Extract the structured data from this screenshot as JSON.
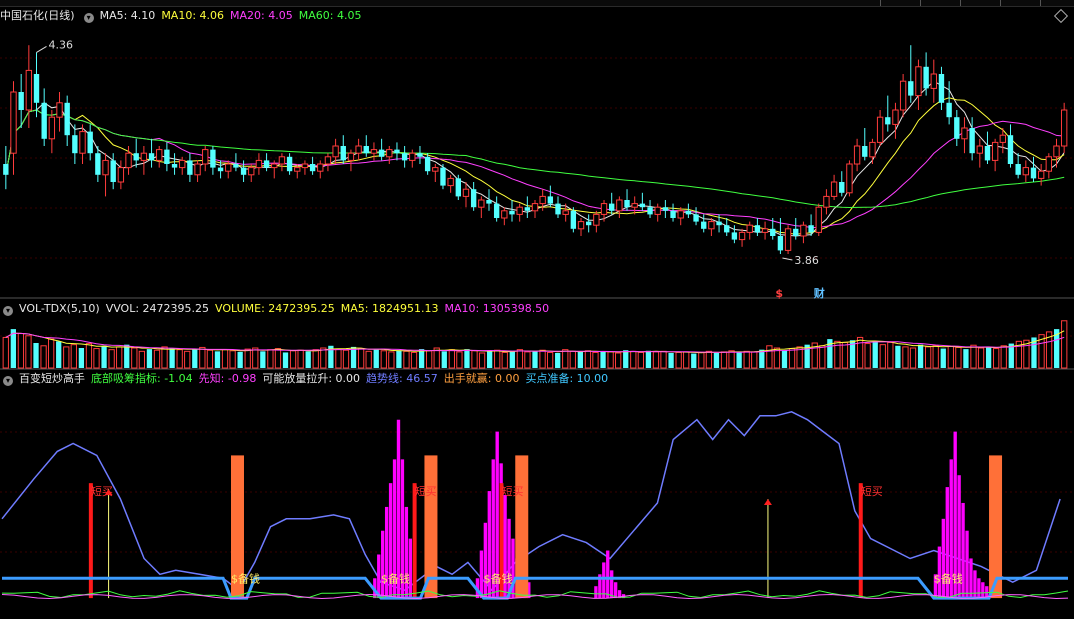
{
  "stock_title": "中国石化(日线)",
  "panels": {
    "price": {
      "labels": [
        {
          "key": "ma5",
          "text": "MA5: 4.10",
          "color": "#e8e8e8"
        },
        {
          "key": "ma10",
          "text": "MA10: 4.06",
          "color": "#ffff3c"
        },
        {
          "key": "ma20",
          "text": "MA20: 4.05",
          "color": "#ff40ff"
        },
        {
          "key": "ma60",
          "text": "MA60: 4.05",
          "color": "#40ff40"
        }
      ]
    },
    "volume": {
      "name": "VOL-TDX(5,10)",
      "labels": [
        {
          "key": "vvol",
          "text": "VVOL: 2472395.25",
          "color": "#e8e8e8"
        },
        {
          "key": "volume",
          "text": "VOLUME: 2472395.25",
          "color": "#ffff3c"
        },
        {
          "key": "ma5",
          "text": "MA5: 1824951.13",
          "color": "#ffff3c"
        },
        {
          "key": "ma10",
          "text": "MA10: 1305398.50",
          "color": "#ff40ff"
        }
      ]
    },
    "indicator": {
      "name": "百变短炒高手",
      "labels": [
        {
          "key": "bottom",
          "text": "底部吸筹指标: -1.04",
          "color": "#40ff40"
        },
        {
          "key": "prophet",
          "text": "先知: -0.98",
          "color": "#ff40ff"
        },
        {
          "key": "rise",
          "text": "可能放量拉升: 0.00",
          "color": "#e8e8e8"
        },
        {
          "key": "trend",
          "text": "趋势线: 46.57",
          "color": "#6f7cff"
        },
        {
          "key": "win",
          "text": "出手就赢: 0.00",
          "color": "#ffa040"
        },
        {
          "key": "ready",
          "text": "买点准备: 10.00",
          "color": "#40c8ff"
        }
      ]
    }
  },
  "chart_data": [
    {
      "type": "candlestick",
      "title": "中国石化(日线)",
      "series_ma": [
        "MA5",
        "MA10",
        "MA20",
        "MA60"
      ],
      "ylim": [
        3.7,
        4.45
      ],
      "annotations": [
        {
          "text": "4.36",
          "kind": "high-marker",
          "index": 4
        },
        {
          "text": "3.86",
          "kind": "low-marker",
          "index": 101
        },
        {
          "text": "$",
          "kind": "signal",
          "index": 101
        },
        {
          "text": "财",
          "kind": "signal",
          "index": 106
        }
      ],
      "candles": [
        [
          4.05,
          4.1,
          3.98,
          4.02
        ],
        [
          4.08,
          4.28,
          4.02,
          4.25
        ],
        [
          4.25,
          4.3,
          4.15,
          4.2
        ],
        [
          4.2,
          4.38,
          4.15,
          4.31
        ],
        [
          4.3,
          4.36,
          4.18,
          4.22
        ],
        [
          4.22,
          4.26,
          4.1,
          4.12
        ],
        [
          4.12,
          4.2,
          4.08,
          4.18
        ],
        [
          4.18,
          4.25,
          4.14,
          4.22
        ],
        [
          4.22,
          4.24,
          4.1,
          4.13
        ],
        [
          4.13,
          4.16,
          4.05,
          4.08
        ],
        [
          4.08,
          4.16,
          4.05,
          4.14
        ],
        [
          4.14,
          4.16,
          4.06,
          4.08
        ],
        [
          4.08,
          4.1,
          4.0,
          4.02
        ],
        [
          4.02,
          4.08,
          3.96,
          4.06
        ],
        [
          4.06,
          4.08,
          3.98,
          4.0
        ],
        [
          4.0,
          4.06,
          3.98,
          4.04
        ],
        [
          4.04,
          4.1,
          4.02,
          4.08
        ],
        [
          4.08,
          4.12,
          4.04,
          4.06
        ],
        [
          4.06,
          4.1,
          4.02,
          4.08
        ],
        [
          4.08,
          4.12,
          4.04,
          4.06
        ],
        [
          4.06,
          4.1,
          4.04,
          4.09
        ],
        [
          4.09,
          4.11,
          4.03,
          4.05
        ],
        [
          4.05,
          4.08,
          4.02,
          4.04
        ],
        [
          4.04,
          4.07,
          4.02,
          4.06
        ],
        [
          4.06,
          4.08,
          4.0,
          4.02
        ],
        [
          4.02,
          4.06,
          4.0,
          4.05
        ],
        [
          4.05,
          4.1,
          4.03,
          4.09
        ],
        [
          4.09,
          4.1,
          4.02,
          4.04
        ],
        [
          4.04,
          4.06,
          4.01,
          4.03
        ],
        [
          4.03,
          4.06,
          4.01,
          4.05
        ],
        [
          4.05,
          4.08,
          4.03,
          4.04
        ],
        [
          4.04,
          4.06,
          4.0,
          4.02
        ],
        [
          4.02,
          4.05,
          4.0,
          4.04
        ],
        [
          4.04,
          4.08,
          4.02,
          4.06
        ],
        [
          4.06,
          4.08,
          4.03,
          4.04
        ],
        [
          4.04,
          4.06,
          4.01,
          4.05
        ],
        [
          4.05,
          4.08,
          4.03,
          4.07
        ],
        [
          4.07,
          4.08,
          4.02,
          4.03
        ],
        [
          4.03,
          4.05,
          4.01,
          4.04
        ],
        [
          4.04,
          4.06,
          4.02,
          4.05
        ],
        [
          4.05,
          4.07,
          4.02,
          4.03
        ],
        [
          4.03,
          4.06,
          4.01,
          4.05
        ],
        [
          4.05,
          4.08,
          4.03,
          4.07
        ],
        [
          4.07,
          4.12,
          4.05,
          4.1
        ],
        [
          4.1,
          4.13,
          4.05,
          4.06
        ],
        [
          4.06,
          4.09,
          4.03,
          4.08
        ],
        [
          4.08,
          4.12,
          4.06,
          4.1
        ],
        [
          4.1,
          4.13,
          4.07,
          4.08
        ],
        [
          4.08,
          4.11,
          4.06,
          4.09
        ],
        [
          4.09,
          4.12,
          4.06,
          4.07
        ],
        [
          4.07,
          4.1,
          4.05,
          4.09
        ],
        [
          4.09,
          4.11,
          4.06,
          4.08
        ],
        [
          4.08,
          4.1,
          4.04,
          4.06
        ],
        [
          4.06,
          4.09,
          4.04,
          4.08
        ],
        [
          4.08,
          4.1,
          4.05,
          4.07
        ],
        [
          4.07,
          4.08,
          4.02,
          4.03
        ],
        [
          4.03,
          4.05,
          4.0,
          4.04
        ],
        [
          4.04,
          4.05,
          3.98,
          3.99
        ],
        [
          3.99,
          4.02,
          3.97,
          4.01
        ],
        [
          4.01,
          4.02,
          3.95,
          3.96
        ],
        [
          3.96,
          4.0,
          3.93,
          3.98
        ],
        [
          3.98,
          4.0,
          3.92,
          3.93
        ],
        [
          3.93,
          3.96,
          3.9,
          3.95
        ],
        [
          3.95,
          3.98,
          3.92,
          3.94
        ],
        [
          3.94,
          3.96,
          3.89,
          3.9
        ],
        [
          3.9,
          3.93,
          3.88,
          3.92
        ],
        [
          3.92,
          3.95,
          3.89,
          3.91
        ],
        [
          3.91,
          3.94,
          3.89,
          3.93
        ],
        [
          3.93,
          3.96,
          3.9,
          3.92
        ],
        [
          3.92,
          3.95,
          3.9,
          3.94
        ],
        [
          3.94,
          3.98,
          3.92,
          3.96
        ],
        [
          3.96,
          3.99,
          3.93,
          3.94
        ],
        [
          3.94,
          3.96,
          3.9,
          3.91
        ],
        [
          3.91,
          3.94,
          3.89,
          3.92
        ],
        [
          3.92,
          3.93,
          3.86,
          3.87
        ],
        [
          3.87,
          3.9,
          3.85,
          3.89
        ],
        [
          3.89,
          3.91,
          3.86,
          3.88
        ],
        [
          3.88,
          3.92,
          3.86,
          3.91
        ],
        [
          3.91,
          3.95,
          3.89,
          3.94
        ],
        [
          3.94,
          3.97,
          3.91,
          3.92
        ],
        [
          3.92,
          3.96,
          3.9,
          3.95
        ],
        [
          3.95,
          3.98,
          3.92,
          3.93
        ],
        [
          3.93,
          3.96,
          3.91,
          3.94
        ],
        [
          3.94,
          3.97,
          3.92,
          3.93
        ],
        [
          3.93,
          3.95,
          3.9,
          3.91
        ],
        [
          3.91,
          3.94,
          3.89,
          3.93
        ],
        [
          3.93,
          3.95,
          3.9,
          3.92
        ],
        [
          3.92,
          3.94,
          3.89,
          3.9
        ],
        [
          3.9,
          3.93,
          3.88,
          3.92
        ],
        [
          3.92,
          3.94,
          3.9,
          3.91
        ],
        [
          3.91,
          3.93,
          3.88,
          3.89
        ],
        [
          3.89,
          3.91,
          3.86,
          3.87
        ],
        [
          3.87,
          3.9,
          3.85,
          3.89
        ],
        [
          3.89,
          3.91,
          3.86,
          3.88
        ],
        [
          3.88,
          3.9,
          3.85,
          3.86
        ],
        [
          3.86,
          3.88,
          3.83,
          3.84
        ],
        [
          3.84,
          3.87,
          3.82,
          3.86
        ],
        [
          3.86,
          3.89,
          3.84,
          3.88
        ],
        [
          3.88,
          3.9,
          3.85,
          3.86
        ],
        [
          3.86,
          3.89,
          3.84,
          3.87
        ],
        [
          3.87,
          3.9,
          3.84,
          3.85
        ],
        [
          3.85,
          3.9,
          3.8,
          3.81
        ],
        [
          3.81,
          3.88,
          3.8,
          3.87
        ],
        [
          3.87,
          3.9,
          3.84,
          3.85
        ],
        [
          3.85,
          3.89,
          3.83,
          3.88
        ],
        [
          3.88,
          3.91,
          3.85,
          3.86
        ],
        [
          3.86,
          3.94,
          3.85,
          3.93
        ],
        [
          3.93,
          3.98,
          3.91,
          3.96
        ],
        [
          3.96,
          4.02,
          3.95,
          4.0
        ],
        [
          4.0,
          4.03,
          3.96,
          3.97
        ],
        [
          3.97,
          4.06,
          3.96,
          4.05
        ],
        [
          4.05,
          4.12,
          4.03,
          4.1
        ],
        [
          4.1,
          4.15,
          4.06,
          4.07
        ],
        [
          4.07,
          4.12,
          4.05,
          4.11
        ],
        [
          4.11,
          4.2,
          4.1,
          4.18
        ],
        [
          4.18,
          4.24,
          4.14,
          4.16
        ],
        [
          4.16,
          4.22,
          4.12,
          4.2
        ],
        [
          4.2,
          4.3,
          4.18,
          4.28
        ],
        [
          4.28,
          4.38,
          4.22,
          4.24
        ],
        [
          4.24,
          4.34,
          4.2,
          4.32
        ],
        [
          4.32,
          4.36,
          4.24,
          4.26
        ],
        [
          4.26,
          4.34,
          4.22,
          4.3
        ],
        [
          4.3,
          4.32,
          4.2,
          4.22
        ],
        [
          4.22,
          4.28,
          4.16,
          4.18
        ],
        [
          4.18,
          4.2,
          4.1,
          4.12
        ],
        [
          4.12,
          4.18,
          4.08,
          4.15
        ],
        [
          4.15,
          4.18,
          4.06,
          4.08
        ],
        [
          4.08,
          4.12,
          4.04,
          4.1
        ],
        [
          4.1,
          4.14,
          4.05,
          4.06
        ],
        [
          4.06,
          4.12,
          4.03,
          4.11
        ],
        [
          4.11,
          4.15,
          4.08,
          4.13
        ],
        [
          4.13,
          4.16,
          4.04,
          4.05
        ],
        [
          4.05,
          4.08,
          4.01,
          4.02
        ],
        [
          4.02,
          4.06,
          4.0,
          4.04
        ],
        [
          4.04,
          4.07,
          4.0,
          4.01
        ],
        [
          4.01,
          4.05,
          3.99,
          4.03
        ],
        [
          4.03,
          4.08,
          4.01,
          4.07
        ],
        [
          4.07,
          4.12,
          4.04,
          4.1
        ],
        [
          4.1,
          4.22,
          4.08,
          4.2
        ]
      ]
    },
    {
      "type": "bar",
      "title": "VOL-TDX(5,10)",
      "series_ma": [
        "MA5",
        "MA10"
      ],
      "values": [
        55,
        70,
        62,
        58,
        45,
        40,
        52,
        48,
        38,
        42,
        36,
        44,
        35,
        40,
        33,
        38,
        42,
        36,
        30,
        34,
        32,
        38,
        35,
        33,
        30,
        34,
        37,
        32,
        30,
        33,
        31,
        29,
        34,
        36,
        30,
        33,
        35,
        28,
        31,
        32,
        30,
        33,
        36,
        40,
        34,
        32,
        38,
        35,
        30,
        33,
        31,
        29,
        32,
        30,
        28,
        34,
        31,
        36,
        30,
        33,
        29,
        34,
        31,
        27,
        30,
        32,
        28,
        31,
        33,
        29,
        30,
        32,
        28,
        27,
        33,
        30,
        29,
        31,
        28,
        30,
        29,
        27,
        32,
        30,
        28,
        31,
        29,
        30,
        27,
        28,
        29,
        26,
        28,
        30,
        27,
        29,
        31,
        28,
        30,
        29,
        33,
        40,
        36,
        32,
        35,
        38,
        42,
        45,
        40,
        52,
        48,
        46,
        50,
        55,
        44,
        48,
        42,
        46,
        40,
        38,
        36,
        42,
        38,
        40,
        35,
        39,
        37,
        34,
        41,
        36,
        38,
        35,
        40,
        44,
        48,
        50,
        55,
        60,
        65,
        70,
        85
      ]
    },
    {
      "type": "bar",
      "title": "百变短炒高手",
      "ylim": [
        -5,
        105
      ],
      "signals": [
        {
          "text": "短买",
          "index": 22
        },
        {
          "text": "短买",
          "index": 104
        },
        {
          "text": "短买",
          "index": 126
        },
        {
          "text": "短买",
          "index": 217
        }
      ],
      "ready_labels": [
        {
          "text": "$备钱",
          "index": 58
        },
        {
          "text": "$备钱",
          "index": 96
        },
        {
          "text": "$备钱",
          "index": 122
        },
        {
          "text": "$备钱",
          "index": 236
        }
      ]
    }
  ]
}
